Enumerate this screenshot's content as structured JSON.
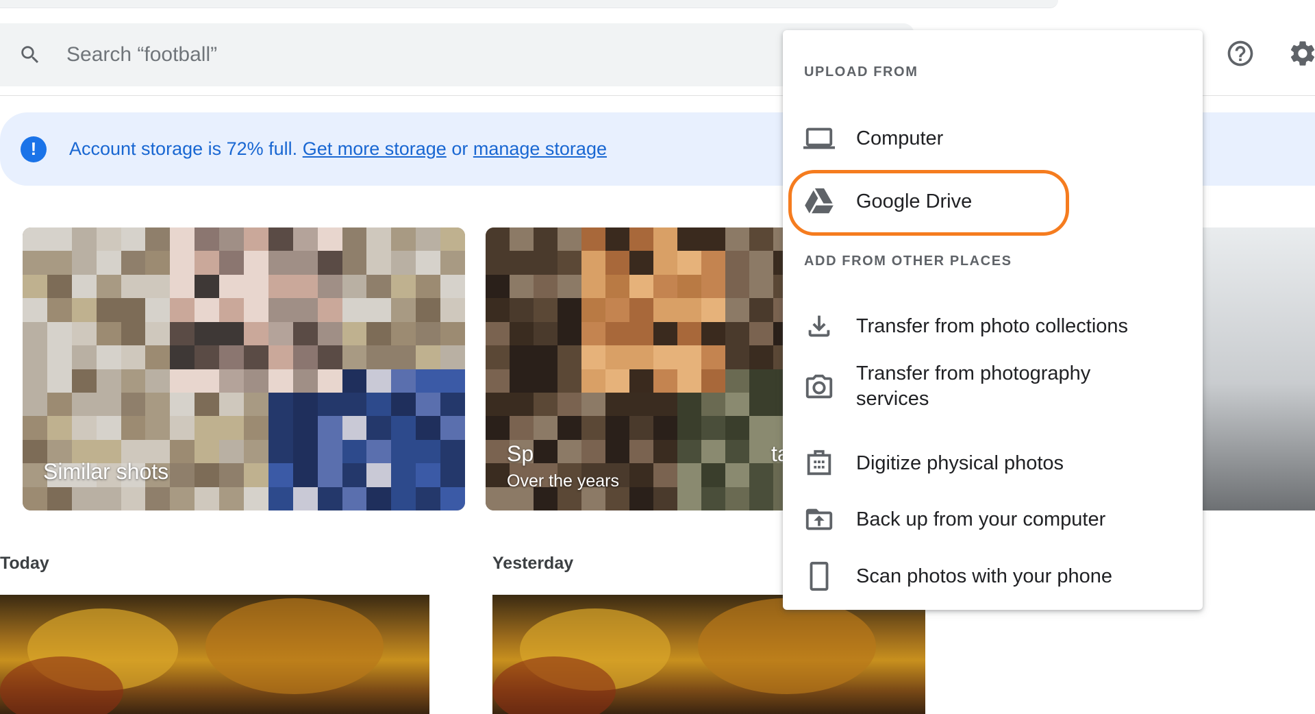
{
  "search": {
    "placeholder": "Search “football”"
  },
  "banner": {
    "text_before": "Account storage is 72% full.",
    "link_more": "Get more storage",
    "text_or": "or",
    "link_manage": "manage storage"
  },
  "cards": [
    {
      "caption": "Similar shots"
    },
    {
      "caption": "Sp",
      "caption_tail": "ta",
      "subcaption": "Over the years"
    }
  ],
  "dates": {
    "today": "Today",
    "yesterday": "Yesterday"
  },
  "menu": {
    "upload_title": "UPLOAD FROM",
    "upload_items": [
      {
        "label": "Computer",
        "icon": "laptop-icon"
      },
      {
        "label": "Google Drive",
        "icon": "google-drive-icon"
      }
    ],
    "other_title": "ADD FROM OTHER PLACES",
    "other_items": [
      {
        "label": "Transfer from photo collections",
        "icon": "download-icon"
      },
      {
        "label": "Transfer from photography services",
        "icon": "camera-transfer-icon"
      },
      {
        "label": "Digitize physical photos",
        "icon": "digitize-icon"
      },
      {
        "label": "Back up from your computer",
        "icon": "backup-upload-icon"
      },
      {
        "label": "Scan photos with your phone",
        "icon": "phone-icon"
      }
    ]
  },
  "colors": {
    "accent": "#1a73e8",
    "banner_bg": "#e8f0fe",
    "highlight": "#f57c1f"
  }
}
